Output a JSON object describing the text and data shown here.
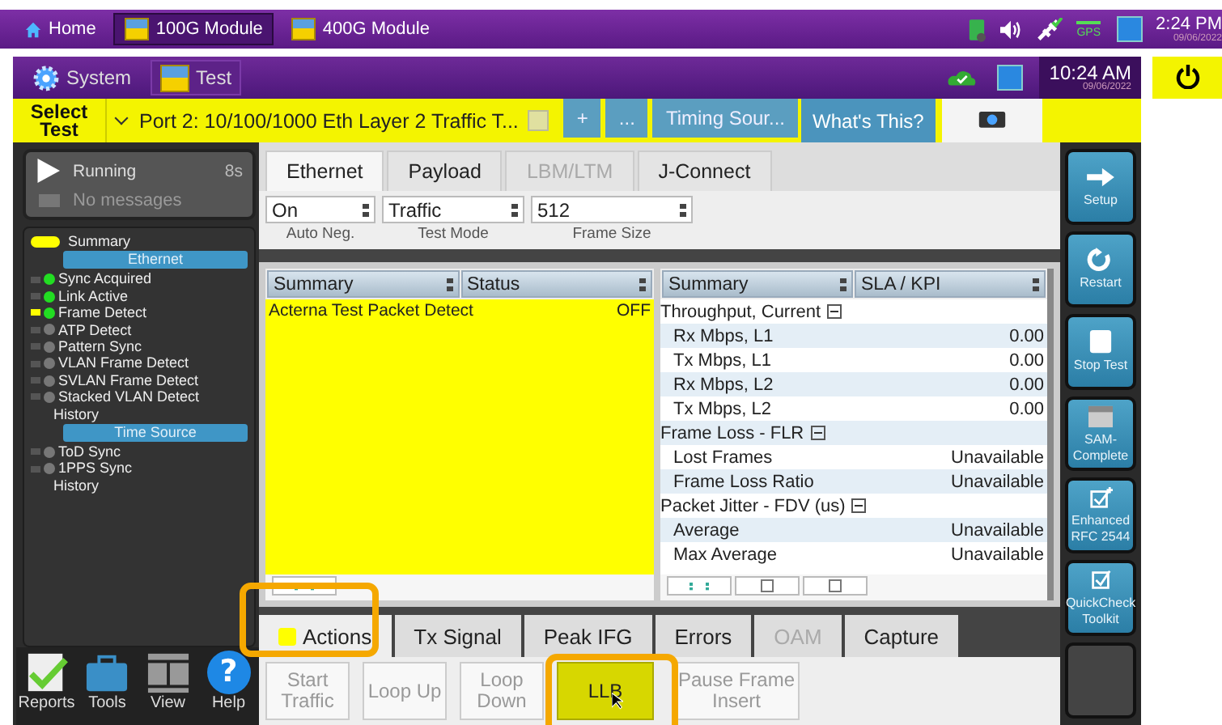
{
  "top_bar": {
    "tabs": [
      {
        "label": "Home",
        "kind": "home",
        "selected": false
      },
      {
        "label": "100G Module",
        "kind": "module",
        "selected": true
      },
      {
        "label": "400G Module",
        "kind": "module",
        "selected": false
      }
    ],
    "gps_label": "GPS",
    "time": "2:24 PM",
    "date": "09/06/2022"
  },
  "header": {
    "tabs": [
      {
        "label": "System",
        "kind": "gear",
        "selected": false
      },
      {
        "label": "Test",
        "kind": "module",
        "selected": true
      }
    ],
    "time": "10:24 AM",
    "date": "09/06/2022"
  },
  "test_bar": {
    "select_label": "Select Test",
    "port_title": "Port 2: 10/100/1000 Eth Layer 2 Traffic T...",
    "tabs": [
      {
        "label": "+",
        "selected": false
      },
      {
        "label": "...",
        "selected": false
      },
      {
        "label": "Timing Sour...",
        "selected": false
      }
    ],
    "help": "What's This?"
  },
  "status": {
    "state": "Running",
    "elapsed": "8s",
    "message": "No messages"
  },
  "tree": {
    "summary": "Summary",
    "groups": [
      {
        "title": "Ethernet",
        "items": [
          {
            "label": "Sync Acquired",
            "color": "#22dd22",
            "selected": false
          },
          {
            "label": "Link Active",
            "color": "#22dd22",
            "selected": false
          },
          {
            "label": "Frame Detect",
            "color": "#22dd22",
            "selected": true
          },
          {
            "label": "ATP Detect",
            "color": "#777777",
            "selected": false
          },
          {
            "label": "Pattern Sync",
            "color": "#777777",
            "selected": false
          },
          {
            "label": "VLAN Frame Detect",
            "color": "#777777",
            "selected": false
          },
          {
            "label": "SVLAN Frame Detect",
            "color": "#777777",
            "selected": false
          },
          {
            "label": "Stacked VLAN Detect",
            "color": "#777777",
            "selected": false
          }
        ],
        "history": "History"
      },
      {
        "title": "Time Source",
        "items": [
          {
            "label": "ToD Sync",
            "color": "#777777",
            "selected": false
          },
          {
            "label": "1PPS Sync",
            "color": "#777777",
            "selected": false
          }
        ],
        "history": "History"
      }
    ]
  },
  "bottom_tools": [
    {
      "label": "Reports",
      "kind": "reports"
    },
    {
      "label": "Tools",
      "kind": "tools"
    },
    {
      "label": "View",
      "kind": "view"
    },
    {
      "label": "Help",
      "kind": "help",
      "glyph": "?"
    }
  ],
  "setup_tabs": [
    {
      "label": "Ethernet",
      "selected": true,
      "disabled": false
    },
    {
      "label": "Payload",
      "selected": false,
      "disabled": false
    },
    {
      "label": "LBM/LTM",
      "selected": false,
      "disabled": true
    },
    {
      "label": "J-Connect",
      "selected": false,
      "disabled": false
    }
  ],
  "settings": [
    {
      "value": "On",
      "label": "Auto Neg."
    },
    {
      "value": "Traffic",
      "label": "Test Mode"
    },
    {
      "value": "512",
      "label": "Frame Size"
    }
  ],
  "left_table": {
    "columns": [
      "Summary",
      "Status"
    ],
    "rows": [
      {
        "name": "Acterna Test Packet Detect",
        "value": "OFF"
      }
    ]
  },
  "right_table": {
    "columns": [
      "Summary",
      "SLA / KPI"
    ],
    "rows": [
      {
        "kind": "group",
        "name": "Throughput, Current",
        "expanded": true
      },
      {
        "kind": "row",
        "name": "Rx Mbps, L1",
        "value": "0.00"
      },
      {
        "kind": "row",
        "name": "Tx Mbps, L1",
        "value": "0.00"
      },
      {
        "kind": "row",
        "name": "Rx Mbps, L2",
        "value": "0.00"
      },
      {
        "kind": "row",
        "name": "Tx Mbps, L2",
        "value": "0.00"
      },
      {
        "kind": "group",
        "name": "Frame Loss - FLR",
        "expanded": true
      },
      {
        "kind": "row",
        "name": "Lost Frames",
        "value": "Unavailable"
      },
      {
        "kind": "row",
        "name": "Frame Loss Ratio",
        "value": "Unavailable"
      },
      {
        "kind": "group",
        "name": "Packet Jitter - FDV (us)",
        "expanded": true
      },
      {
        "kind": "row",
        "name": "Average",
        "value": "Unavailable"
      },
      {
        "kind": "row",
        "name": "Max Average",
        "value": "Unavailable"
      }
    ]
  },
  "action_tabs": [
    {
      "label": "Actions",
      "selected": true,
      "disabled": false
    },
    {
      "label": "Tx Signal",
      "selected": false,
      "disabled": false
    },
    {
      "label": "Peak IFG",
      "selected": false,
      "disabled": false
    },
    {
      "label": "Errors",
      "selected": false,
      "disabled": false
    },
    {
      "label": "OAM",
      "selected": false,
      "disabled": true
    },
    {
      "label": "Capture",
      "selected": false,
      "disabled": false
    }
  ],
  "actions": [
    {
      "label": "Start Traffic",
      "on": false,
      "disabled": true
    },
    {
      "label": "Loop Up",
      "on": false,
      "disabled": true
    },
    {
      "label": "Loop Down",
      "on": false,
      "disabled": true
    },
    {
      "label": "LLB",
      "on": true,
      "disabled": false
    },
    {
      "label": "Pause Frame Insert",
      "on": false,
      "disabled": true
    }
  ],
  "side_buttons": [
    {
      "label": "Setup",
      "kind": "arrow"
    },
    {
      "label": "Restart",
      "kind": "restart"
    },
    {
      "label": "Stop Test",
      "kind": "stop"
    },
    {
      "label": "SAM-Complete",
      "kind": "window"
    },
    {
      "label": "Enhanced RFC 2544",
      "kind": "check-plus"
    },
    {
      "label": "QuickCheck Toolkit",
      "kind": "check"
    },
    {
      "kind": "blank"
    }
  ]
}
